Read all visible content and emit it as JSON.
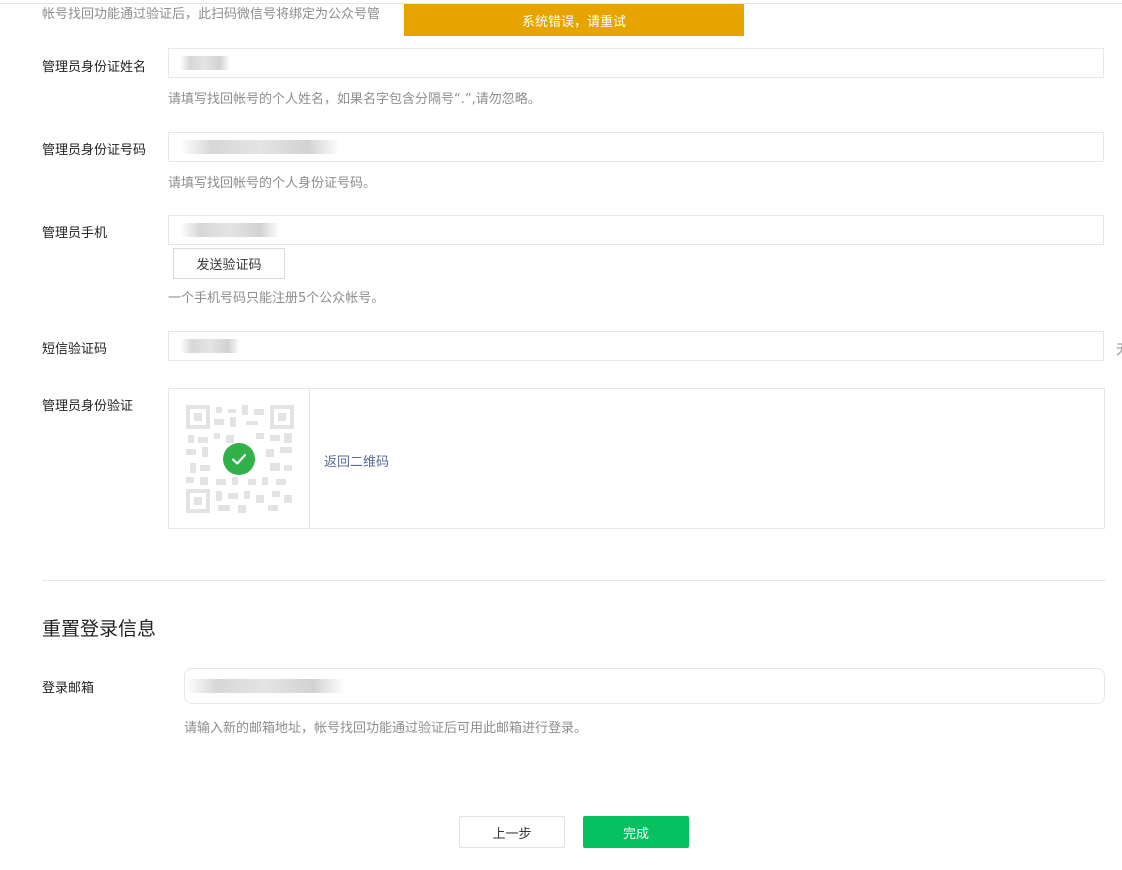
{
  "intro": {
    "text": "帐号找回功能通过验证后，此扫码微信号将绑定为公众号管"
  },
  "toast": {
    "text": "系统错误，请重试",
    "color": "#e7a400"
  },
  "fields": {
    "admin_name": {
      "label": "管理员身份证姓名",
      "hint": "请填写找回帐号的个人姓名，如果名字包含分隔号“.”,请勿忽略。"
    },
    "admin_id": {
      "label": "管理员身份证号码",
      "hint": "请填写找回帐号的个人身份证号码。"
    },
    "admin_phone": {
      "label": "管理员手机",
      "send_code_label": "发送验证码",
      "hint": "一个手机号码只能注册5个公众帐号。"
    },
    "sms_code": {
      "label": "短信验证码",
      "trailing_fragment": "无"
    },
    "identity": {
      "label": "管理员身份验证",
      "qr_icon": "qr-code-icon",
      "check_icon": "check-circle-icon",
      "back_link": "返回二维码"
    }
  },
  "reset": {
    "title": "重置登录信息",
    "email": {
      "label": "登录邮箱",
      "hint": "请输入新的邮箱地址，帐号找回功能通过验证后可用此邮箱进行登录。"
    }
  },
  "actions": {
    "prev_label": "上一步",
    "done_label": "完成"
  },
  "colors": {
    "accent_green": "#07c160",
    "link": "#576b95",
    "warning": "#e7a400",
    "success": "#31b14a"
  }
}
